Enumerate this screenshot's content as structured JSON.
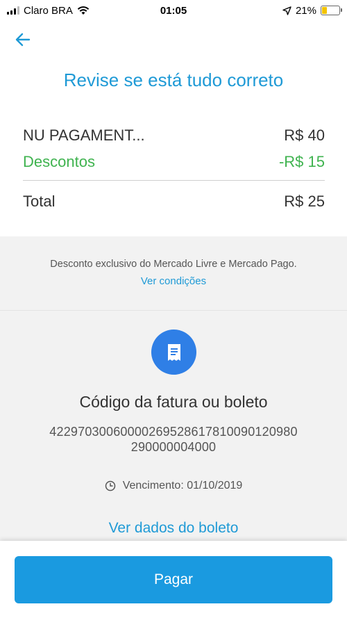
{
  "status_bar": {
    "carrier": "Claro BRA",
    "time": "01:05",
    "battery": "21%"
  },
  "header": {
    "title": "Revise se está tudo correto"
  },
  "summary": {
    "item_label": "NU PAGAMENT...",
    "item_value": "R$ 40",
    "discount_label": "Descontos",
    "discount_value": "-R$ 15",
    "total_label": "Total",
    "total_value": "R$ 25"
  },
  "disclaimer": {
    "text": "Desconto exclusivo do Mercado Livre e Mercado Pago.",
    "link": "Ver condições"
  },
  "boleto": {
    "title": "Código da fatura ou boleto",
    "code_line1": "42297030060000269528617810090120980",
    "code_line2": "290000004000",
    "due_date": "Vencimento: 01/10/2019",
    "details_link": "Ver dados do boleto"
  },
  "footer": {
    "pay_label": "Pagar"
  },
  "colors": {
    "accent": "#1f9ad6",
    "discount": "#3fb34f",
    "button": "#1a9ae0",
    "icon_circle": "#2f7fe6"
  },
  "icons": [
    "signal-icon",
    "wifi-icon",
    "location-icon",
    "battery-icon",
    "back-arrow-icon",
    "receipt-icon",
    "clock-icon"
  ]
}
